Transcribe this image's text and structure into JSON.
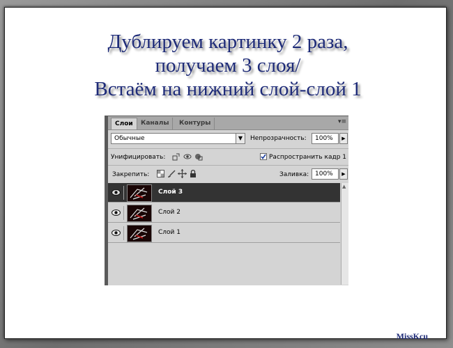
{
  "slide": {
    "title_lines": [
      "Дублируем картинку 2 раза,",
      "получаем 3 слоя/",
      "Встаём на нижний слой-слой 1"
    ],
    "credit": "MissKcu",
    "title_color": "#1e2b78"
  },
  "panel": {
    "tabs": [
      "Слои",
      "Каналы",
      "Контуры"
    ],
    "menu_icon": "panel-menu-icon",
    "blend_mode": "Обычные",
    "opacity_label": "Непрозрачность:",
    "opacity_value": "100%",
    "unify_label": "Унифицировать:",
    "propagate_label": "Распространить кадр 1",
    "propagate_checked": true,
    "lock_label": "Закрепить:",
    "fill_label": "Заливка:",
    "fill_value": "100%",
    "layers": [
      {
        "name": "Слой 3",
        "selected": true,
        "visible": true
      },
      {
        "name": "Слой 2",
        "selected": false,
        "visible": true
      },
      {
        "name": "Слой 1",
        "selected": false,
        "visible": true
      }
    ]
  }
}
